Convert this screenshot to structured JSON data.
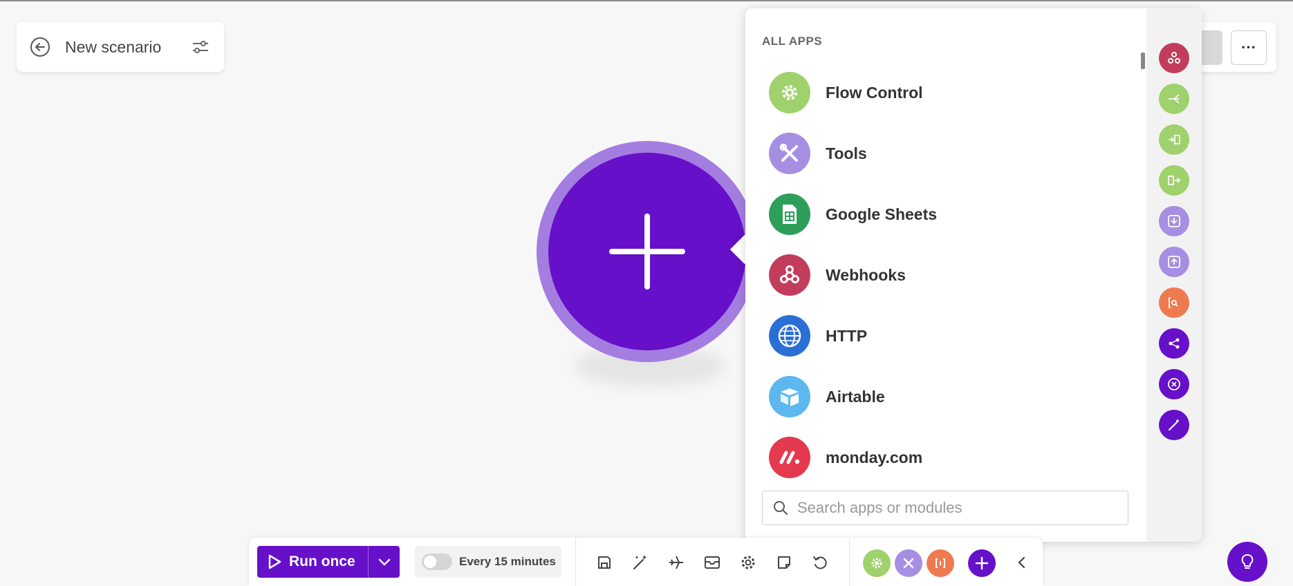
{
  "scenario": {
    "title": "New scenario",
    "back_icon": "arrow-left-circle-icon",
    "settings_icon": "sliders-icon"
  },
  "header_right": {
    "more_label": "···"
  },
  "popup": {
    "heading": "ALL APPS",
    "apps": [
      {
        "name": "Flow Control",
        "icon": "gear-icon",
        "color": "#9fd16c"
      },
      {
        "name": "Tools",
        "icon": "tools-icon",
        "color": "#a68ee3"
      },
      {
        "name": "Google Sheets",
        "icon": "sheet-icon",
        "color": "#2e9e5b"
      },
      {
        "name": "Webhooks",
        "icon": "webhook-icon",
        "color": "#c23d5c"
      },
      {
        "name": "HTTP",
        "icon": "globe-icon",
        "color": "#2a6fd6"
      },
      {
        "name": "Airtable",
        "icon": "airtable-icon",
        "color": "#5db8f0"
      },
      {
        "name": "monday.com",
        "icon": "monday-icon",
        "color": "#e53950"
      }
    ],
    "search_placeholder": "Search apps or modules",
    "side_rail": [
      {
        "icon": "webhook-icon",
        "color": "#c23d5c"
      },
      {
        "icon": "router-icon",
        "color": "#9fd16c"
      },
      {
        "icon": "iterator-icon",
        "color": "#9fd16c"
      },
      {
        "icon": "aggregator-icon",
        "color": "#9fd16c"
      },
      {
        "icon": "download-icon",
        "color": "#a68ee3"
      },
      {
        "icon": "upload-icon",
        "color": "#a68ee3"
      },
      {
        "icon": "text-search-icon",
        "color": "#ee7a50"
      },
      {
        "icon": "share-icon",
        "color": "#6610c9"
      },
      {
        "icon": "compass-icon",
        "color": "#6610c9"
      },
      {
        "icon": "magic-wand-icon",
        "color": "#6610c9"
      }
    ]
  },
  "toolbar": {
    "run_label": "Run once",
    "schedule_label": "Every 15 minutes",
    "tools": [
      "save-icon",
      "magic-wand-icon",
      "airplane-icon",
      "inbox-icon",
      "gear-icon",
      "note-icon",
      "undo-icon"
    ],
    "favorites": [
      {
        "icon": "gear-icon",
        "color": "#9fd16c"
      },
      {
        "icon": "tools-icon",
        "color": "#a68ee3"
      },
      {
        "icon": "text-parser-icon",
        "color": "#ee7a50"
      }
    ]
  },
  "colors": {
    "brand": "#6610c9",
    "brand_light": "#a47de0"
  }
}
